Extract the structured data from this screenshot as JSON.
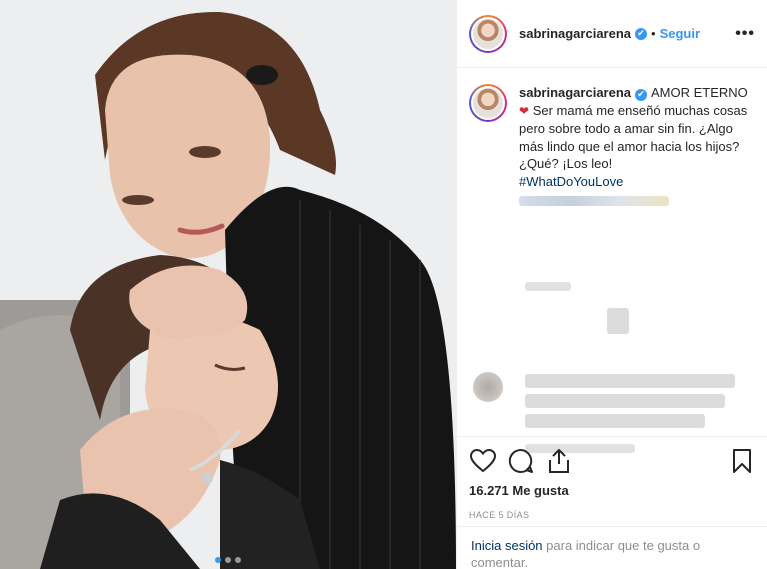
{
  "post": {
    "username": "sabrinagarciarena",
    "verified_mark": "✔",
    "separator": "•",
    "follow_label": "Seguir",
    "more_label": "•••",
    "caption_title": "AMOR ETERNO",
    "caption_heart": "❤",
    "caption_text": "Ser mamá me enseñó muchas cosas pero sobre todo a amar sin fin. ¿Algo más lindo que el amor hacia los hijos? ¿Qué? ¡Los leo!",
    "hashtag": "#WhatDoYouLove",
    "likes": "16.271 Me gusta",
    "timestamp": "HACE 5 DÍAS",
    "login_link": "Inicia sesión",
    "login_rest": " para indicar que te gusta o comentar."
  },
  "icons": {
    "like": "heart-icon",
    "comment": "comment-icon",
    "share": "share-icon",
    "save": "bookmark-icon",
    "verified": "verified-badge-icon"
  },
  "colors": {
    "accent_blue": "#3897f0",
    "hashtag_blue": "#003569",
    "muted_gray": "#8e8e8e",
    "border": "#efefef"
  },
  "carousel": {
    "total": 3,
    "active_index": 1
  }
}
